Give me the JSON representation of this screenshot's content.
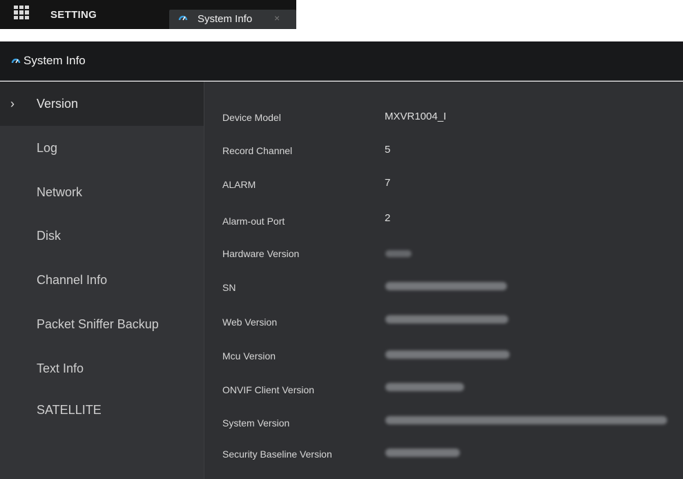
{
  "topbar": {
    "setting_label": "SETTING",
    "active_tab_label": "System Info",
    "close_glyph": "×",
    "icons": [
      "grid-icon",
      "dashboard-gauge-icon",
      "close-icon"
    ]
  },
  "header": {
    "title": "System Info",
    "icon": "dashboard-gauge-icon"
  },
  "sidebar": {
    "active_index": 0,
    "chevron": "›",
    "items": [
      {
        "label": "Version"
      },
      {
        "label": "Log"
      },
      {
        "label": "Network"
      },
      {
        "label": "Disk"
      },
      {
        "label": "Channel Info"
      },
      {
        "label": "Packet Sniffer Backup"
      },
      {
        "label": "Text Info"
      },
      {
        "label": "SATELLITE"
      }
    ]
  },
  "main": {
    "rows": [
      {
        "label": "Device Model",
        "value": "MXVR1004_I"
      },
      {
        "label": "Record Channel",
        "value": "5"
      },
      {
        "label": "ALARM",
        "value": "7"
      },
      {
        "label": "Alarm-out Port",
        "value": "2"
      },
      {
        "label": "Hardware Version",
        "value": ""
      },
      {
        "label": "SN",
        "value": ""
      },
      {
        "label": "Web Version",
        "value": ""
      },
      {
        "label": "Mcu Version",
        "value": ""
      },
      {
        "label": "ONVIF Client Version",
        "value": ""
      },
      {
        "label": "System Version",
        "value": ""
      },
      {
        "label": "Security Baseline Version",
        "value": ""
      }
    ]
  },
  "colors": {
    "accent": "#3aa0e0",
    "header_bg": "#18191b",
    "sidebar_bg": "#333437",
    "main_bg": "#2f3033"
  }
}
